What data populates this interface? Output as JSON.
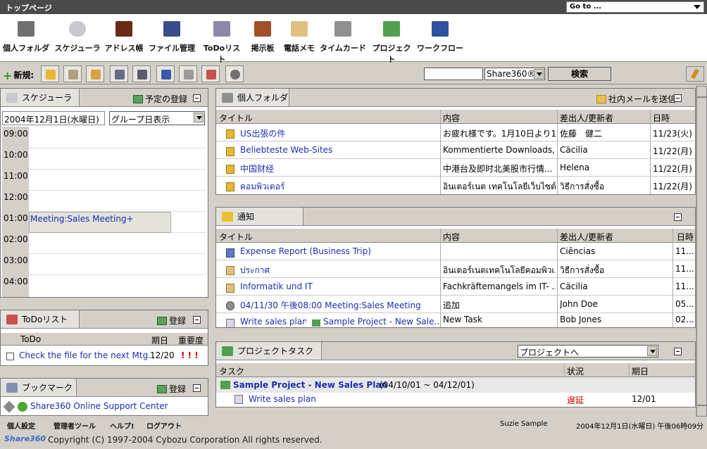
{
  "topbar": {
    "title": "トップページ",
    "goto": "Go to ..."
  },
  "apps": [
    {
      "label": "個人フォルダ",
      "icon": "briefcase-icon",
      "color": "#707070"
    },
    {
      "label": "スケジューラ",
      "icon": "clock-icon",
      "color": "#c8c8d0"
    },
    {
      "label": "アドレス帳",
      "icon": "address-book-icon",
      "color": "#6a2a18"
    },
    {
      "label": "ファイル管理",
      "icon": "binders-icon",
      "color": "#3a4a8a"
    },
    {
      "label": "ToDoリスト",
      "icon": "checklist-icon",
      "color": "#8a8aa8"
    },
    {
      "label": "掲示板",
      "icon": "board-icon",
      "color": "#a05028"
    },
    {
      "label": "電話メモ",
      "icon": "phone-icon",
      "color": "#e0c080"
    },
    {
      "label": "タイムカード",
      "icon": "timecard-icon",
      "color": "#909090"
    },
    {
      "label": "プロジェクト",
      "icon": "chart-icon",
      "color": "#50a050"
    },
    {
      "label": "ワークフロー",
      "icon": "workflow-icon",
      "color": "#3050a0"
    }
  ],
  "toolbar": {
    "new_label": "新規:",
    "search_value": "",
    "search_scope": "Share360®",
    "search_button": "検索"
  },
  "scheduler": {
    "title": "スケジューラ",
    "add_label": "予定の登録",
    "date": "2004年12月1日(水曜日)",
    "view": "グループ日表示",
    "hours": [
      "09:00",
      "10:00",
      "11:00",
      "12:00",
      "01:00",
      "02:00",
      "03:00",
      "04:00"
    ],
    "event": "Meeting:Sales Meeting+"
  },
  "todo": {
    "title": "ToDoリスト",
    "add_label": "登録",
    "col_todo": "ToDo",
    "col_due": "期日",
    "col_prio": "重要度",
    "items": [
      {
        "text": "Check the file for the next Mtg.",
        "due": "12/20",
        "prio": "! ! !"
      }
    ]
  },
  "bookmark": {
    "title": "ブックマーク",
    "add_label": "登録",
    "items": [
      "Share360 Online Support Center"
    ]
  },
  "folder": {
    "title": "個人フォルダ",
    "action": "社内メールを送信",
    "col_title": "タイトル",
    "col_content": "内容",
    "col_sender": "差出人/更新者",
    "col_date": "日時",
    "rows": [
      {
        "title": "US出張の件",
        "content": "お疲れ様です。1月10日より1...",
        "sender": "佐藤　健二",
        "date": "11/23(火)"
      },
      {
        "title": "Beliebteste Web-Sites",
        "content": "Kommentierte Downloads,...",
        "sender": "Cäcilia",
        "date": "11/22(月)"
      },
      {
        "title": "中国财经",
        "content": "中港台及即时北美股市行情...",
        "sender": "Helena",
        "date": "11/22(月)"
      },
      {
        "title": "คอมพิวเตอร์",
        "content": "อินเตอร์เนต เทคโนโลยีเว็บไซต์",
        "sender": "วิธีการสั่งซื้อ",
        "date": "11/22(月)"
      }
    ]
  },
  "notice": {
    "title": "通知",
    "col_title": "タイトル",
    "col_content": "内容",
    "col_sender": "差出人/更新者",
    "col_date": "日時",
    "rows": [
      {
        "title": "Expense Report (Business Trip)",
        "content": "",
        "sender": "Ciências",
        "date": "11..."
      },
      {
        "title": "ประกาศ",
        "content": "อินเตอร์เนตเทคโนโลยีคอมพิวเ...",
        "sender": "วิธีการสั่งซื้อ",
        "date": "11..."
      },
      {
        "title": "Informatik und IT",
        "content": "Fachkräftemangels im IT- ...",
        "sender": "Cäcilia",
        "date": "11..."
      },
      {
        "title": "04/11/30 午後08:00  Meeting:Sales Meeting",
        "content": "追加",
        "sender": "John Doe",
        "date": "05..."
      },
      {
        "title": "Write sales plan",
        "title2": "Sample Project - New Sale...",
        "content": "New Task",
        "sender": "Bob Jones",
        "date": "02..."
      }
    ]
  },
  "project": {
    "title": "プロジェクトタスク",
    "select": "プロジェクトへ",
    "col_task": "タスク",
    "col_status": "状況",
    "col_due": "期日",
    "project_name": "Sample Project - New Sales Plan",
    "project_range": "(04/10/01 ~ 04/12/01)",
    "task": "Write sales plan",
    "status": "遅延",
    "due": "12/01"
  },
  "footer": {
    "nav": [
      "個人設定",
      "管理者ツール",
      "ヘルプ!",
      "ログアウト"
    ],
    "user": "Suzie Sample",
    "datetime": "2004年12月1日(水曜日) 午後06時09分",
    "copyright": "Copyright (C) 1997-2004 Cybozu Corporation All rights reserved.",
    "logo": "Share360"
  }
}
